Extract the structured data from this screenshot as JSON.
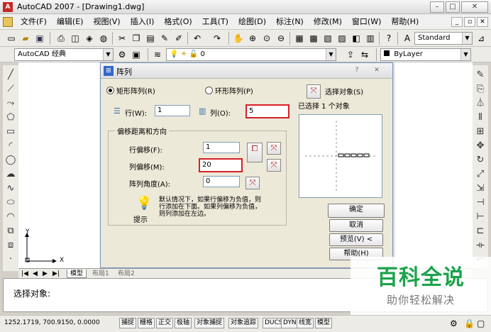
{
  "window": {
    "title": "AutoCAD 2007 - [Drawing1.dwg]",
    "app_icon": "A"
  },
  "menu": {
    "items": [
      "文件(F)",
      "编辑(E)",
      "视图(V)",
      "插入(I)",
      "格式(O)",
      "工具(T)",
      "绘图(D)",
      "标注(N)",
      "修改(M)",
      "窗口(W)",
      "帮助(H)"
    ]
  },
  "toolbar": {
    "text_style": "Standard",
    "workspace": "AutoCAD 经典",
    "layer": "0",
    "linetype": "ByLayer"
  },
  "dialog": {
    "title": "阵列",
    "radio_rect": "矩形阵列(R)",
    "radio_polar": "环形阵列(P)",
    "select_objects_label": "选择对象(S)",
    "selected_status": "已选择 1 个对象",
    "rows_label": "行(W):",
    "rows_value": "1",
    "cols_label": "列(O):",
    "cols_value": "5",
    "offset_group_label": "偏移距离和方向",
    "row_offset_label": "行偏移(F):",
    "row_offset_value": "1",
    "col_offset_label": "列偏移(M):",
    "col_offset_value": "20",
    "angle_label": "阵列角度(A):",
    "angle_value": "0",
    "tip_line1": "默认情况下，如果行偏移为负值，则",
    "tip_line2": "行添加在下面。如果列偏移为负值，",
    "tip_line3": "则列添加在左边。",
    "tip_label": "提示",
    "ok_label": "确定",
    "cancel_label": "取消",
    "preview_label": "预览(V) <",
    "help_label": "帮助(H)"
  },
  "layout_tabs": [
    "模型",
    "布局1",
    "布局2"
  ],
  "ucs": {
    "y_label": "Y",
    "x_label": "X"
  },
  "command": {
    "prompt": "选择对象:"
  },
  "status": {
    "coords": "1252.1719, 700.9150, 0.0000",
    "buttons": [
      "捕捉",
      "栅格",
      "正交",
      "极轴",
      "对象捕捉",
      "对象追踪",
      "DUCS",
      "DYN",
      "线宽",
      "模型"
    ]
  },
  "watermark": {
    "title": "百科全说",
    "subtitle": "助你轻松解决"
  },
  "colors": {
    "highlight": "#d81f26",
    "watermark_green": "#1aa34a"
  }
}
